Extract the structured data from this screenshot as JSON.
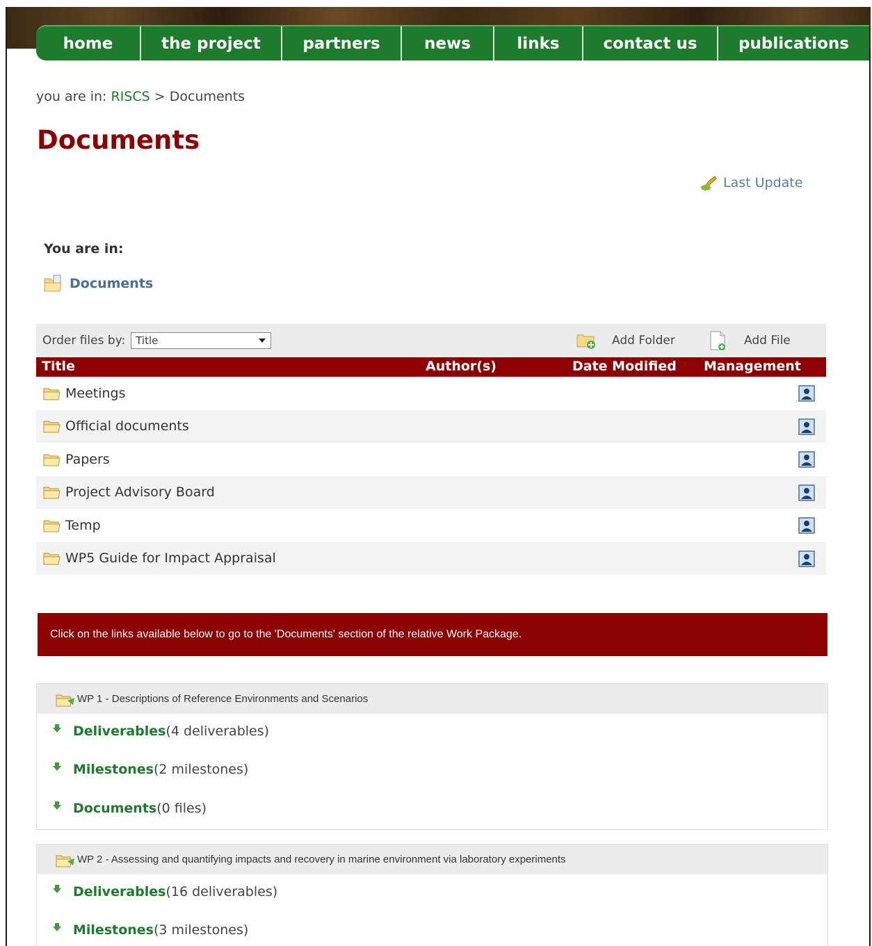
{
  "nav": {
    "items": [
      {
        "label": "home"
      },
      {
        "label": "the project"
      },
      {
        "label": "partners"
      },
      {
        "label": "news"
      },
      {
        "label": "links"
      },
      {
        "label": "contact us"
      },
      {
        "label": "publications"
      }
    ]
  },
  "breadcrumb": {
    "prefix": "you are in:",
    "link": "RISCS",
    "separator": ">",
    "current": "Documents"
  },
  "page": {
    "title": "Documents",
    "last_update": "Last Update"
  },
  "location": {
    "label": "You are in:",
    "folder": "Documents"
  },
  "toolbar": {
    "order_label": "Order files by:",
    "order_value": "Title",
    "add_folder": "Add Folder",
    "add_file": "Add File"
  },
  "table": {
    "columns": [
      "Title",
      "Author(s)",
      "Date Modified",
      "Management"
    ],
    "rows": [
      {
        "title": "Meetings"
      },
      {
        "title": "Official documents"
      },
      {
        "title": "Papers"
      },
      {
        "title": "Project Advisory Board"
      },
      {
        "title": "Temp"
      },
      {
        "title": "WP5 Guide for Impact Appraisal"
      }
    ]
  },
  "info_banner": "Click on the links available below to go to the 'Documents' section of the relative Work Package.",
  "work_packages": [
    {
      "title": "WP 1 - Descriptions of Reference Environments and Scenarios",
      "links": [
        {
          "label": "Deliverables",
          "count": "(4 deliverables)"
        },
        {
          "label": "Milestones",
          "count": "(2 milestones)"
        },
        {
          "label": "Documents",
          "count": " (0 files)"
        }
      ]
    },
    {
      "title": "WP 2 - Assessing and quantifying impacts and recovery in marine environment via laboratory experiments",
      "links": [
        {
          "label": "Deliverables",
          "count": "(16 deliverables)"
        },
        {
          "label": "Milestones",
          "count": "(3 milestones)"
        }
      ]
    }
  ],
  "colors": {
    "nav_green": "#1e7a2c",
    "title_red": "#8b0000",
    "link_green": "#1e7a2c",
    "folder_blue": "#4a6e96"
  }
}
